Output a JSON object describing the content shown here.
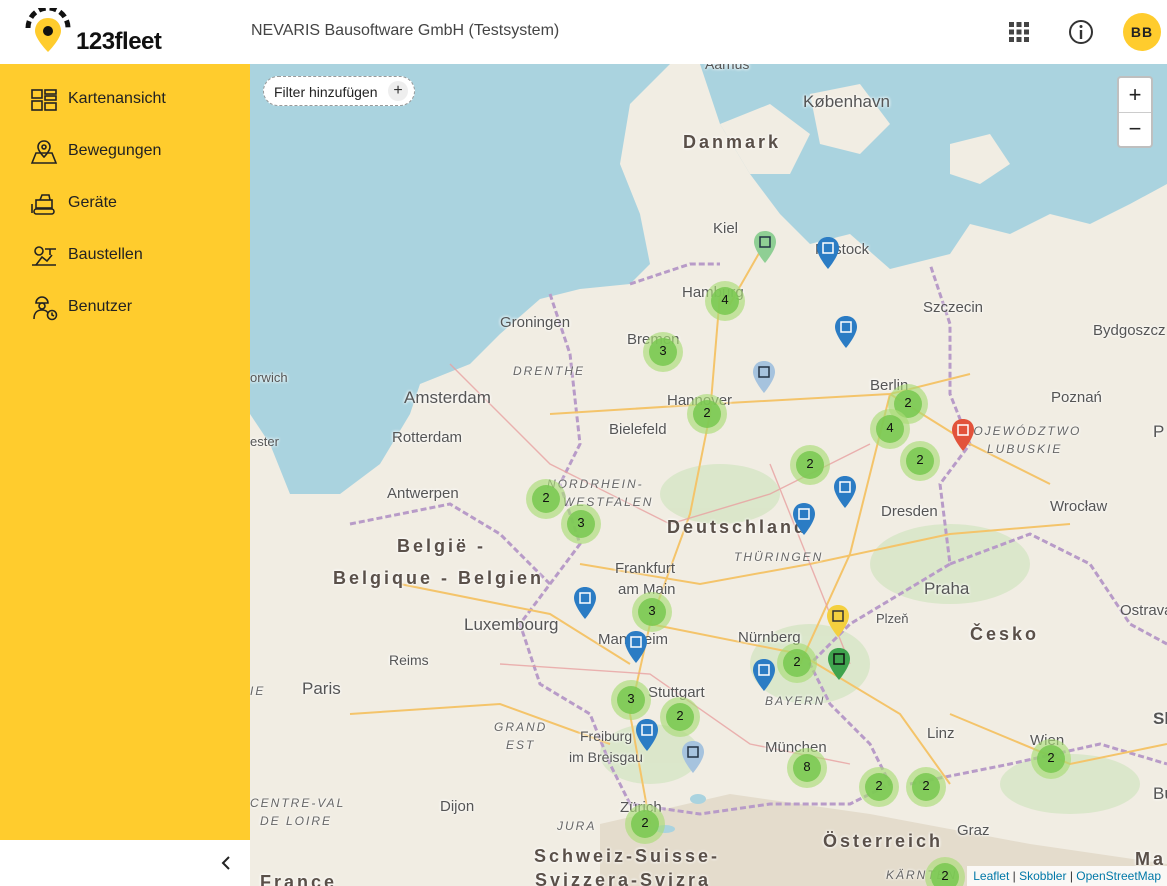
{
  "header": {
    "logo_text": "123fleet",
    "company": "NEVARIS Bausoftware GmbH (Testsystem)",
    "avatar_initials": "BB"
  },
  "sidebar": {
    "items": [
      {
        "label": "Kartenansicht",
        "icon": "map-grid-icon"
      },
      {
        "label": "Bewegungen",
        "icon": "map-pin-icon"
      },
      {
        "label": "Geräte",
        "icon": "bulldozer-icon"
      },
      {
        "label": "Baustellen",
        "icon": "construction-site-icon"
      },
      {
        "label": "Benutzer",
        "icon": "worker-icon"
      }
    ]
  },
  "map": {
    "filter_label": "Filter hinzufügen",
    "zoom_in": "+",
    "zoom_out": "−",
    "attribution": {
      "leaflet": "Leaflet",
      "sep": "|",
      "skobbler": "Skobbler",
      "osm": "OpenStreetMap"
    },
    "labels": {
      "danmark": "Danmark",
      "kobenhavn": "København",
      "kiel": "Kiel",
      "rostock": "Rostock",
      "hamburg": "Hamburg",
      "szczecin": "Szczecin",
      "bydgoszcz": "Bydgoszcz",
      "groningen": "Groningen",
      "bremen": "Bremen",
      "drenthe": "DRENTHE",
      "norwich": "orwich",
      "amsterdam": "Amsterdam",
      "hannover": "Hannover",
      "berlin": "Berlin",
      "poznan": "Poznań",
      "rotterdam": "Rotterdam",
      "bielefeld": "Bielefeld",
      "lubuskie1": "WOJEWÓDZTWO",
      "lubuskie2": "LUBUSKIE",
      "antwerpen": "Antwerpen",
      "nrw1": "NORDRHEIN-",
      "nrw2": "WESTFALEN",
      "deutschland": "Deutschland",
      "dresden": "Dresden",
      "wroclaw": "Wrocław",
      "belgie1": "België -",
      "belgie2": "Belgique - Belgien",
      "thueringen": "THÜRINGEN",
      "frankfurt1": "Frankfurt",
      "frankfurt2": "am Main",
      "praha": "Praha",
      "ostrava": "Ostrava",
      "luxembourg": "Luxembourg",
      "mannheim": "Mannheim",
      "nuernberg": "Nürnberg",
      "plzen": "Plzeň",
      "cesko": "Česko",
      "reims": "Reims",
      "paris": "Paris",
      "stuttgart": "Stuttgart",
      "bayern": "BAYERN",
      "grandest1": "GRAND",
      "grandest2": "EST",
      "freiburg1": "Freiburg",
      "freiburg2": "im Breisgau",
      "linz": "Linz",
      "wien": "Wien",
      "muenchen": "München",
      "dijon": "Dijon",
      "centreval": "CENTRE-VAL",
      "loire": "DE LOIRE",
      "zuerich": "Zürich",
      "jura": "JURA",
      "graz": "Graz",
      "schweiz": "Schweiz-Suisse-",
      "svizzera": "Svizzera-Svizra",
      "oesterreich": "Österreich",
      "france": "France",
      "kaernten": "KÄRNTEN",
      "sk": "Sl",
      "bu": "Bu",
      "ma": "Ma",
      "p": "P",
      "ie": "IE",
      "ester": "ester",
      "aarhus": "Aarhus"
    },
    "clusters": [
      {
        "count": "4",
        "id": "hamburg"
      },
      {
        "count": "3",
        "id": "bremen"
      },
      {
        "count": "2",
        "id": "hannover"
      },
      {
        "count": "2",
        "id": "berlin"
      },
      {
        "count": "4",
        "id": "berlin-south"
      },
      {
        "count": "2",
        "id": "cottbus"
      },
      {
        "count": "2",
        "id": "halle"
      },
      {
        "count": "2",
        "id": "ruhr"
      },
      {
        "count": "3",
        "id": "cologne"
      },
      {
        "count": "3",
        "id": "frankfurt"
      },
      {
        "count": "2",
        "id": "nuernberg"
      },
      {
        "count": "3",
        "id": "karlsruhe"
      },
      {
        "count": "2",
        "id": "stuttgart"
      },
      {
        "count": "8",
        "id": "muenchen"
      },
      {
        "count": "2",
        "id": "rosenheim"
      },
      {
        "count": "2",
        "id": "salzburg"
      },
      {
        "count": "2",
        "id": "wien"
      },
      {
        "count": "2",
        "id": "zuerich"
      },
      {
        "count": "2",
        "id": "kaernten"
      }
    ],
    "colors": {
      "water": "#aad3df",
      "land": "#f1ede3",
      "sidebar": "#ffcc2d",
      "cluster": "#8fd16a",
      "pin_blue": "#2b7cc4",
      "pin_red": "#e2533b",
      "pin_yellow": "#f4d03f",
      "pin_green": "#3fa34d"
    }
  }
}
